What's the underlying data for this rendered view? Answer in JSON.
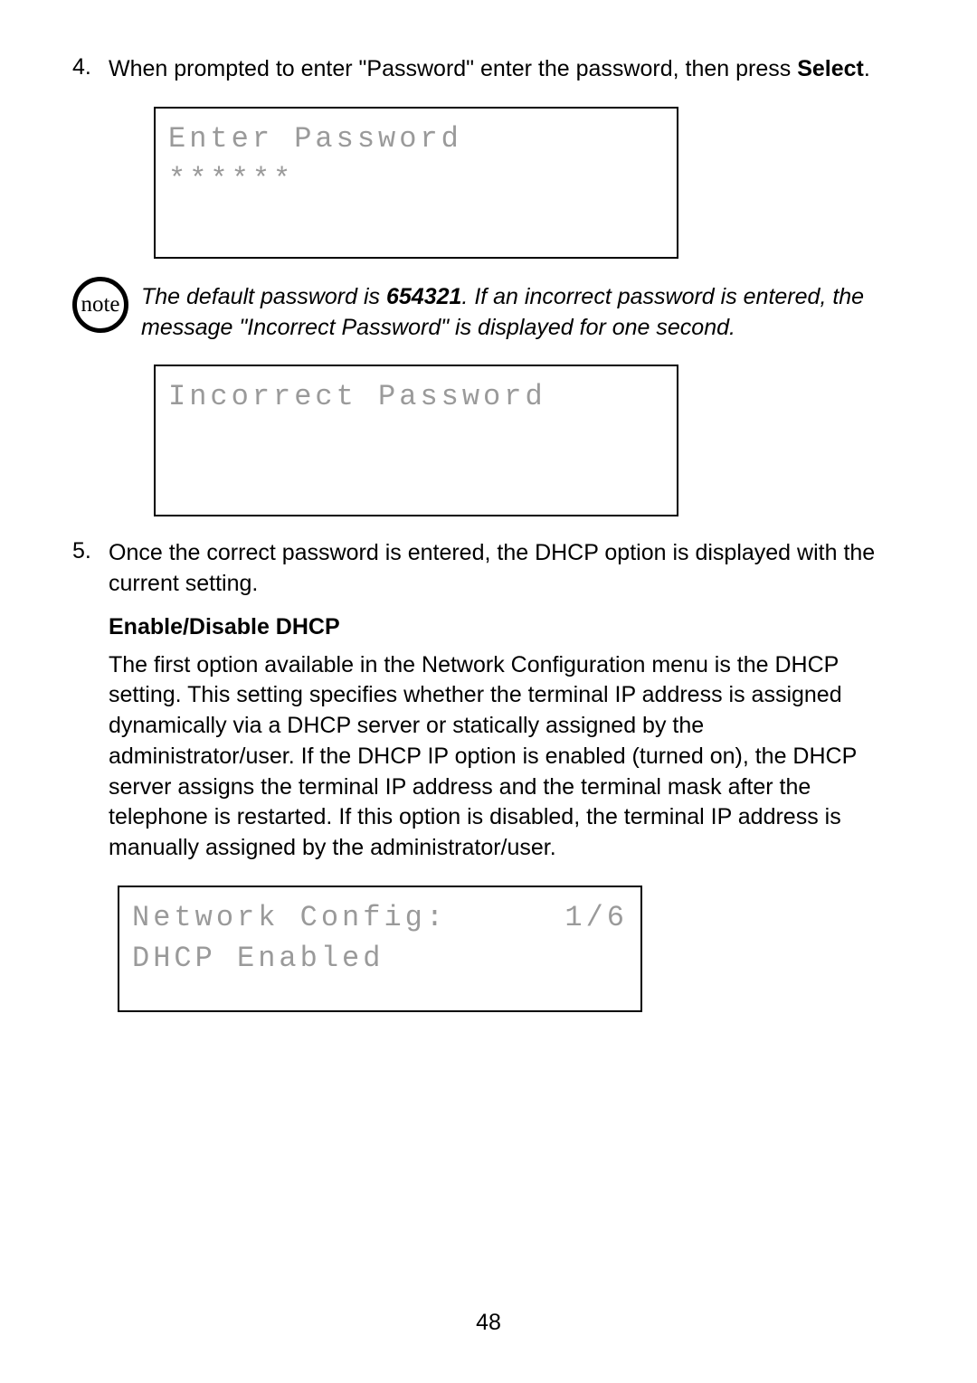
{
  "step4": {
    "number": "4.",
    "text_prefix": "When prompted to enter \"Password\" enter the password, then press ",
    "select_label": "Select",
    "text_suffix": "."
  },
  "lcd1": {
    "line1": "Enter Password",
    "line2": "******"
  },
  "note_icon_label": "note",
  "note": {
    "prefix": "The default password is ",
    "password": "654321",
    "suffix": ". If an incorrect password is entered, the message \"Incorrect Password\" is displayed for one second."
  },
  "lcd2": {
    "line1": "Incorrect Password"
  },
  "step5": {
    "number": "5.",
    "text": "Once the correct password is entered, the DHCP option is displayed with the current setting."
  },
  "section_heading": "Enable/Disable DHCP",
  "dhcp_paragraph": "The first option available in the Network Configuration menu is the DHCP setting. This setting specifies whether the terminal IP address is assigned dynamically via a DHCP server or statically assigned by the administrator/user. If the DHCP IP option is enabled (turned on), the DHCP server assigns the terminal IP address and the terminal mask after the telephone is restarted. If this option is disabled, the terminal IP address is manually assigned by the administrator/user.",
  "lcd3": {
    "line1_left": "Network Config:",
    "line1_right": "1/6",
    "line2": "DHCP Enabled"
  },
  "page_number": "48"
}
